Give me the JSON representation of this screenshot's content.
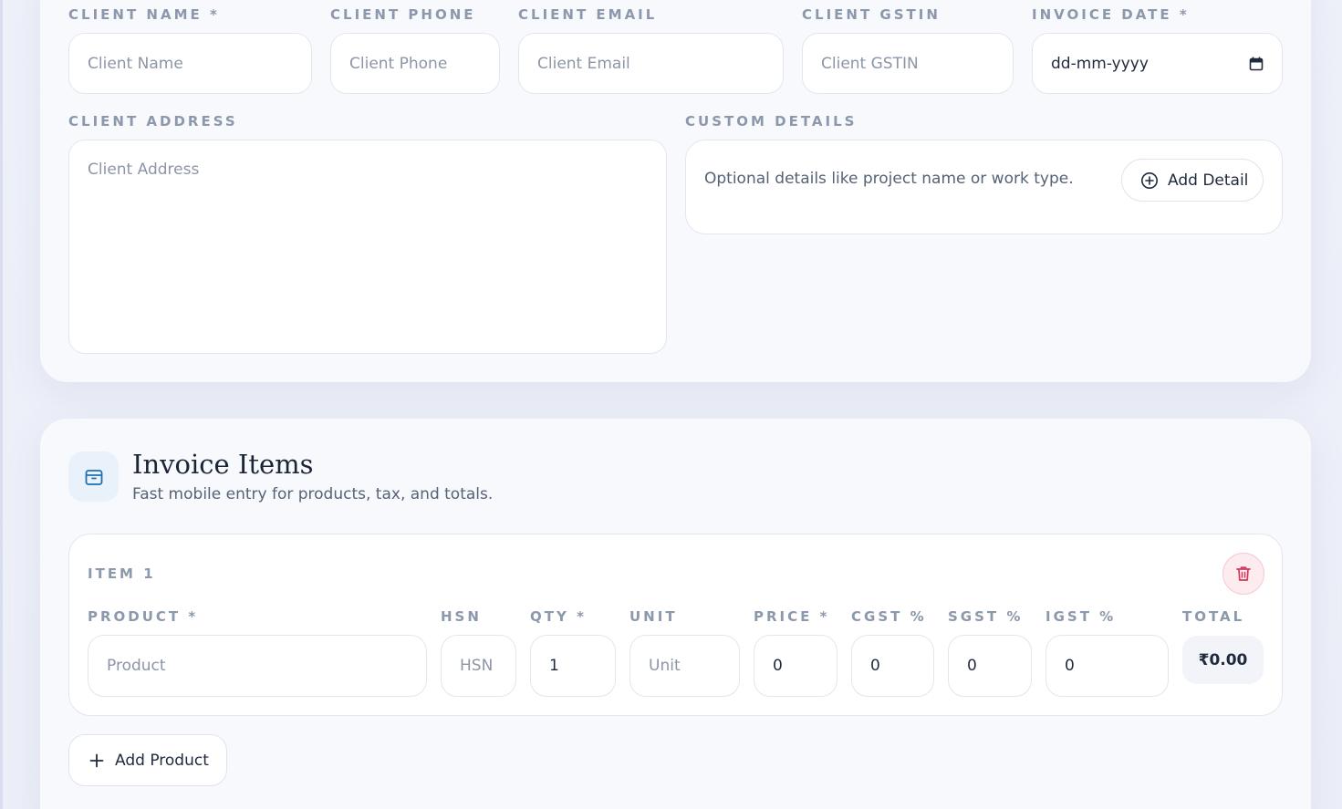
{
  "client": {
    "name_label": "CLIENT NAME *",
    "name_placeholder": "Client Name",
    "phone_label": "CLIENT PHONE",
    "phone_placeholder": "Client Phone",
    "email_label": "CLIENT EMAIL",
    "email_placeholder": "Client Email",
    "gstin_label": "CLIENT GSTIN",
    "gstin_placeholder": "Client GSTIN",
    "date_label": "INVOICE DATE *",
    "date_value": "dd-mm-yyyy",
    "address_label": "CLIENT ADDRESS",
    "address_placeholder": "Client Address"
  },
  "custom_details": {
    "label": "CUSTOM DETAILS",
    "hint": "Optional details like project name or work type.",
    "add_button": "Add Detail",
    "add_icon": "plus-circle-icon"
  },
  "items_section": {
    "icon": "box-icon",
    "title": "Invoice Items",
    "subtitle": "Fast mobile entry for products, tax, and totals.",
    "add_button": "Add Product",
    "items": [
      {
        "title": "ITEM 1",
        "delete_icon": "trash-icon",
        "product_label": "PRODUCT *",
        "product_placeholder": "Product",
        "hsn_label": "HSN",
        "hsn_placeholder": "HSN",
        "qty_label": "QTY *",
        "qty_value": "1",
        "unit_label": "UNIT",
        "unit_placeholder": "Unit",
        "price_label": "PRICE *",
        "price_value": "0",
        "cgst_label": "CGST %",
        "cgst_value": "0",
        "sgst_label": "SGST %",
        "sgst_value": "0",
        "igst_label": "IGST %",
        "igst_value": "0",
        "total_label": "TOTAL",
        "total_value": "₹0.00"
      }
    ]
  },
  "colors": {
    "accent_blue": "#1f6fb0",
    "danger": "#d6355b",
    "label_gray": "#8c98ab"
  }
}
